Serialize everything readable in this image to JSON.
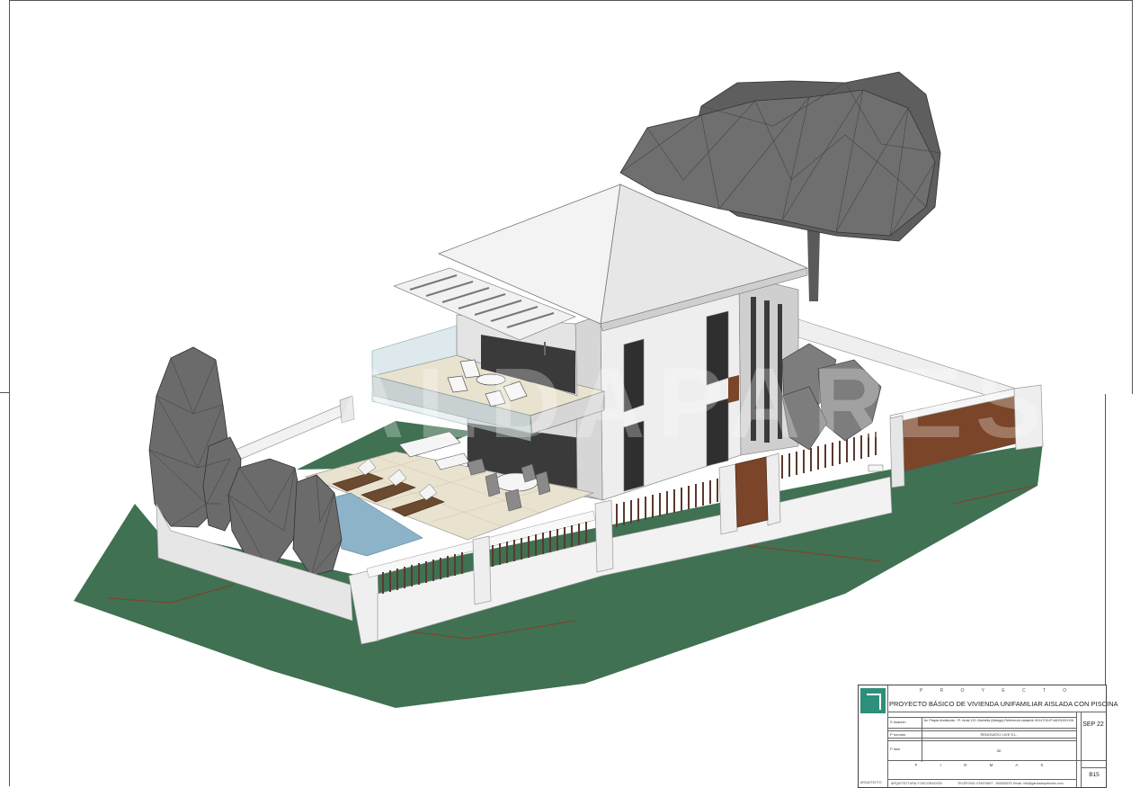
{
  "sheet": {
    "project_heading": "P R O Y E C T O",
    "project_title": "PROYECTO BÁSICO DE VIVIENDA UNIFAMILIAR AISLADA CON PISCINA",
    "architect_label": "ARQUITECTO",
    "signatures_heading": "F I R M A S",
    "date": "SEP 22",
    "sheet_number": "B15",
    "watermark": "ALDAPARES"
  },
  "title_block_rows": [
    {
      "label": "S ituación",
      "value": "Av. Playas Andaluzas - Pl. Ardal 120, Marbella (Málaga)  Referencia catastral: 8014701UF1481S0001XW"
    },
    {
      "label": "P romotor",
      "value": "RENOVATIO LIVE S.L."
    },
    {
      "label": "P lano",
      "value": "3D"
    }
  ],
  "footer_small": {
    "left": "ARQUITECTURA Y DECORACIÓN",
    "mid": "TELÉFONO: 678475697 - 952834575",
    "right": "Email: info@garciaarquitectos.com"
  },
  "colors": {
    "grass": "#3f7152",
    "wall": "#eeeeee",
    "wall_shadow": "#c9c9c9",
    "roof": "#f0f0f0",
    "tree": "#6e6e6e",
    "fence_wood": "#5a3a2e",
    "door_wood": "#7a4529",
    "pool": "#8db3c9",
    "deck": "#e9e2cf",
    "logo_teal": "#2e8f7a"
  }
}
